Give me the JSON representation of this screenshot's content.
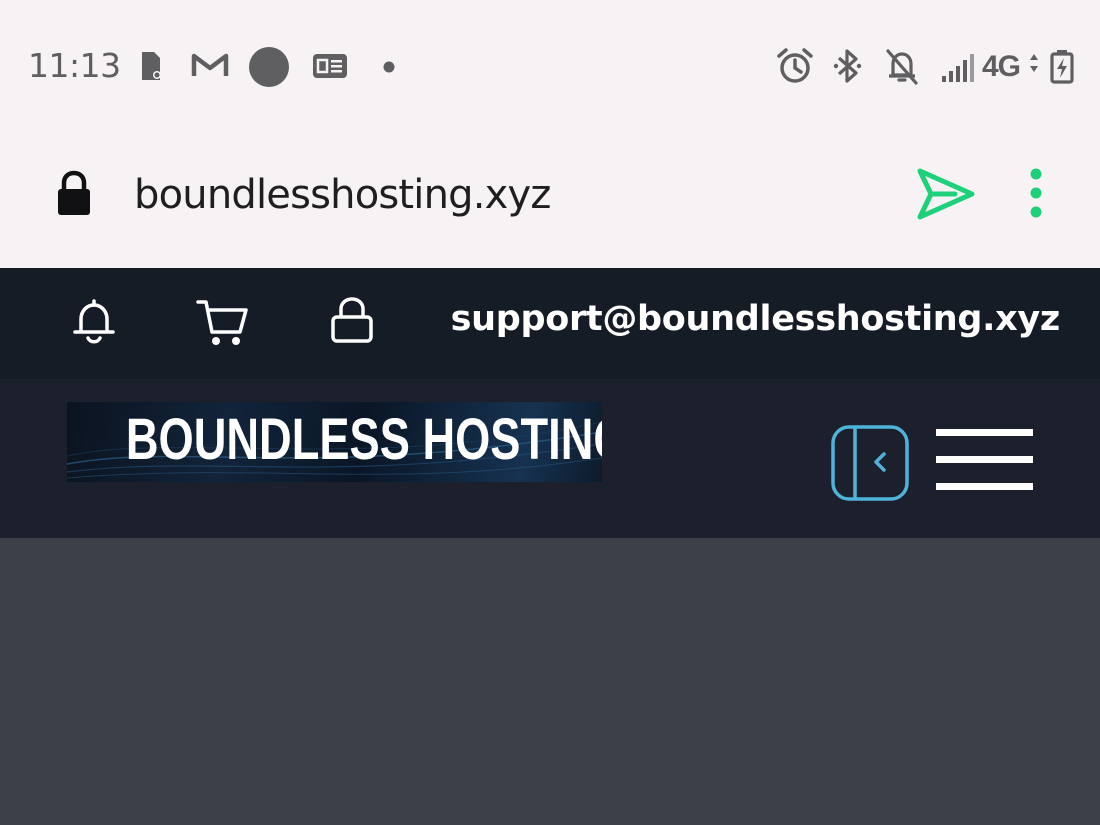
{
  "status_bar": {
    "time": "11:13",
    "notification_icons": [
      "usb-device-icon",
      "gmail-icon",
      "profile-circle-icon",
      "news-icon",
      "more-dot-icon"
    ],
    "system_icons": [
      "alarm-icon",
      "bluetooth-icon",
      "notifications-off-icon",
      "signal-icon",
      "battery-charging-icon"
    ],
    "network": "4G"
  },
  "browser": {
    "url": "boundlesshosting.xyz",
    "accent_color": "#1fd07a"
  },
  "site": {
    "topbar": {
      "support_email": "support@boundlesshosting.xyz",
      "icons": [
        "bell-icon",
        "cart-icon",
        "lock-icon"
      ]
    },
    "header": {
      "logo_text": "BOUNDLESS HOSTING",
      "toggle_accent": "#4fb3d9"
    },
    "colors": {
      "topbar_bg": "#161c26",
      "header_bg": "#1b202c",
      "content_bg": "#3c4049"
    }
  }
}
